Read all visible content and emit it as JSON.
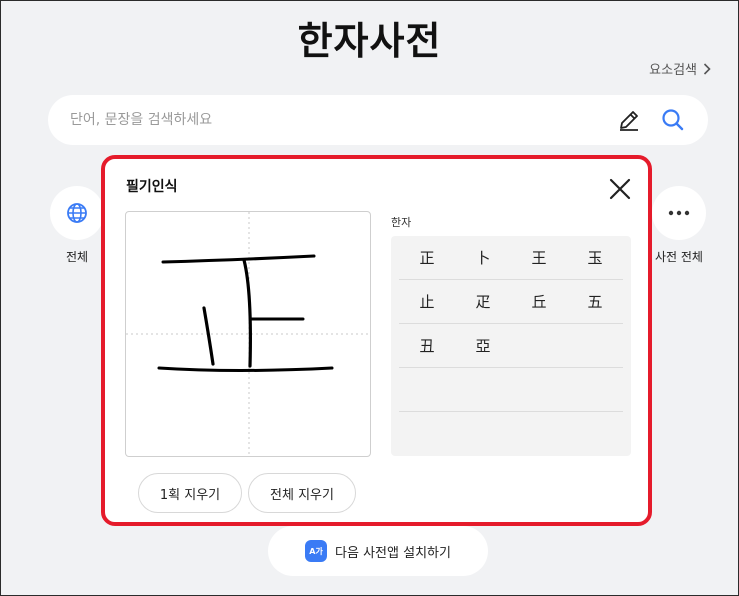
{
  "page": {
    "title": "한자사전",
    "advanced_search": "요소검색",
    "search_placeholder": "단어, 문장을 검색하세요"
  },
  "categories": {
    "left_label": "전체",
    "right_label": "사전 전체"
  },
  "app_banner": {
    "icon_text": "A가",
    "label": "다음 사전앱 설치하기"
  },
  "handwriting": {
    "title": "필기인식",
    "result_label": "한자",
    "results": [
      [
        "正",
        "卜",
        "王",
        "玉"
      ],
      [
        "止",
        "疋",
        "丘",
        "五"
      ],
      [
        "丑",
        "亞",
        "",
        ""
      ],
      [
        "",
        "",
        "",
        ""
      ],
      [
        "",
        "",
        "",
        ""
      ]
    ],
    "undo_stroke": "1획 지우기",
    "clear_all": "전체 지우기"
  },
  "colors": {
    "highlight_border": "#e51b2b",
    "accent_blue": "#3a7bf5"
  }
}
